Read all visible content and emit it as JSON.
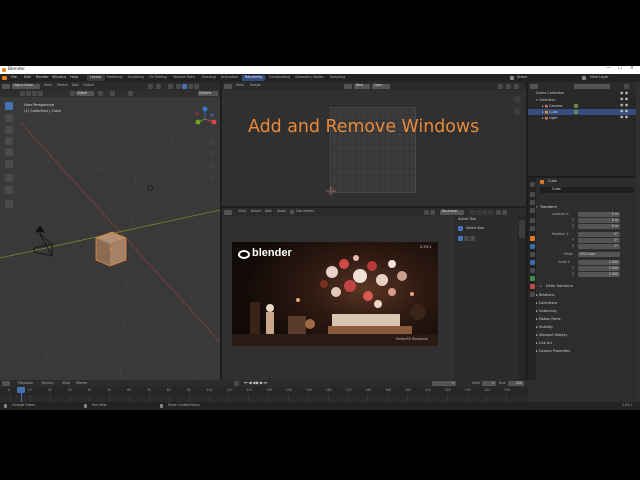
{
  "window_title": "Blender",
  "menu": [
    "File",
    "Edit",
    "Render",
    "Window",
    "Help"
  ],
  "workspaces": [
    {
      "label": "Layout",
      "active": true
    },
    {
      "label": "Modeling"
    },
    {
      "label": "Sculpting"
    },
    {
      "label": "UV Editing"
    },
    {
      "label": "Texture Paint"
    },
    {
      "label": "Shading"
    },
    {
      "label": "Animation"
    },
    {
      "label": "Rendering",
      "highlight": true
    },
    {
      "label": "Compositing"
    },
    {
      "label": "Geometry Nodes"
    },
    {
      "label": "Scripting"
    }
  ],
  "scene": {
    "label": "Scene",
    "layer": "View Layer"
  },
  "viewport3d": {
    "mode": "Object Mode",
    "menus": [
      "View",
      "Select",
      "Add",
      "Object"
    ],
    "transform": "Global",
    "options": "Options",
    "info_line1": "User Perspective",
    "info_line2": "(1) Collection | Cube"
  },
  "image_editor": {
    "menus": [
      "View",
      "Image"
    ],
    "new_label": "New",
    "open_label": "Open"
  },
  "overlay_caption": "Add and Remove Windows",
  "node_editor": {
    "menus": [
      "View",
      "Select",
      "Add",
      "Node"
    ],
    "use_nodes": "Use Nodes",
    "backdrop": "Backdrop"
  },
  "splash": {
    "brand": "blender",
    "version": "2.93.1",
    "credit": "Ember3D Woodland"
  },
  "tool_panel": {
    "active_tool": "Active Tool",
    "select_box": "Select Box"
  },
  "outliner": {
    "title": "Scene Collection",
    "items": [
      {
        "label": "Collection",
        "indent": 1
      },
      {
        "label": "Camera",
        "indent": 2
      },
      {
        "label": "Cube",
        "indent": 2,
        "selected": true
      },
      {
        "label": "Light",
        "indent": 2
      }
    ]
  },
  "properties": {
    "object_name": "Cube",
    "search_name": "Cube",
    "transform_header": "Transform",
    "location_label": "Location X",
    "location": [
      "0 m",
      "0 m",
      "0 m"
    ],
    "rotation_label": "Rotation X",
    "rotation": [
      "0°",
      "0°",
      "0°"
    ],
    "mode_label": "Mode",
    "mode_value": "XYZ Euler",
    "scale_label": "Scale X",
    "scale": [
      "1.000",
      "1.000",
      "1.000"
    ],
    "sub_y": "Y",
    "sub_z": "Z",
    "delta": "Delta Transform",
    "sections": [
      "Relations",
      "Collections",
      "Instancing",
      "Motion Paths",
      "Visibility",
      "Viewport Display",
      "Line Art",
      "Custom Properties"
    ]
  },
  "timeline": {
    "menus": [
      "Playback",
      "Keying",
      "View",
      "Marker"
    ],
    "current_frame": "1",
    "start_label": "Start",
    "start": "1",
    "end_label": "End",
    "end": "250",
    "ticks": [
      "0",
      "10",
      "20",
      "30",
      "40",
      "50",
      "60",
      "70",
      "80",
      "90",
      "100",
      "110",
      "120",
      "130",
      "140",
      "150",
      "160",
      "170",
      "180",
      "190",
      "200",
      "210",
      "220",
      "230",
      "240",
      "250"
    ]
  },
  "statusbar": {
    "left": "Change Frame",
    "mid": "Pan View",
    "right": "Move Context Menu",
    "version": "2.93.1"
  },
  "colors": {
    "accent": "#4772b3",
    "select": "#334d80",
    "orange": "#e88a3a"
  }
}
